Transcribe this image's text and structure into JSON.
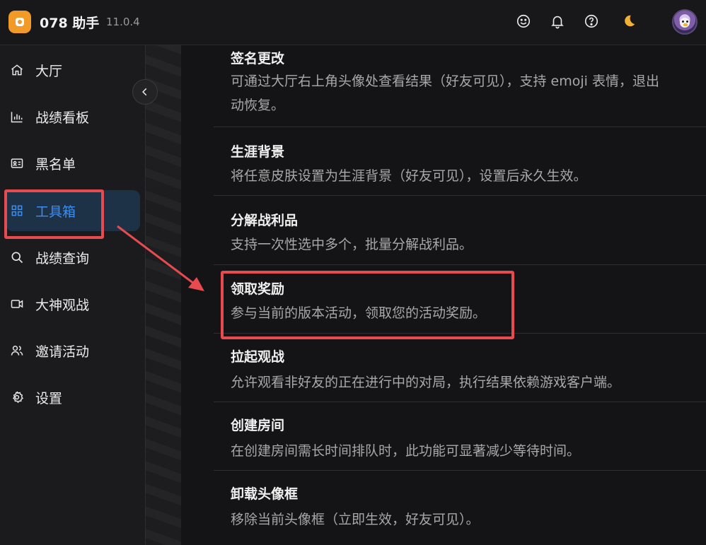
{
  "header": {
    "app_title": "078 助手",
    "version": "11.0.4",
    "icons": [
      "smile-icon",
      "bell-icon",
      "help-icon",
      "moon-icon",
      "avatar"
    ]
  },
  "sidebar": {
    "items": [
      {
        "label": "大厅",
        "icon": "home-icon"
      },
      {
        "label": "战绩看板",
        "icon": "bar-chart-icon"
      },
      {
        "label": "黑名单",
        "icon": "id-card-icon"
      },
      {
        "label": "工具箱",
        "icon": "grid-icon",
        "active": true
      },
      {
        "label": "战绩查询",
        "icon": "search-icon"
      },
      {
        "label": "大神观战",
        "icon": "video-icon"
      },
      {
        "label": "邀请活动",
        "icon": "users-icon"
      },
      {
        "label": "设置",
        "icon": "gear-icon"
      }
    ]
  },
  "tools": [
    {
      "title": "签名更改",
      "desc_line1": "可通过大厅右上角头像处查看结果（好友可见），支持 emoji 表情，退出",
      "desc_line2": "动恢复。"
    },
    {
      "title": "生涯背景",
      "desc_line1": "将任意皮肤设置为生涯背景（好友可见），设置后永久生效。"
    },
    {
      "title": "分解战利品",
      "desc_line1": "支持一次性选中多个，批量分解战利品。"
    },
    {
      "title": "领取奖励",
      "desc_line1": "参与当前的版本活动，领取您的活动奖励。"
    },
    {
      "title": "拉起观战",
      "desc_line1": "允许观看非好友的正在进行中的对局，执行结果依赖游戏客户端。"
    },
    {
      "title": "创建房间",
      "desc_line1": "在创建房间需长时间排队时，此功能可显著减少等待时间。"
    },
    {
      "title": "卸载头像框",
      "desc_line1": "移除当前头像框（立即生效，好友可见）。"
    }
  ],
  "colors": {
    "accent": "#3d8cf0",
    "highlight": "#e74b4f",
    "logo": "#f29a27",
    "moon": "#f2b134"
  }
}
